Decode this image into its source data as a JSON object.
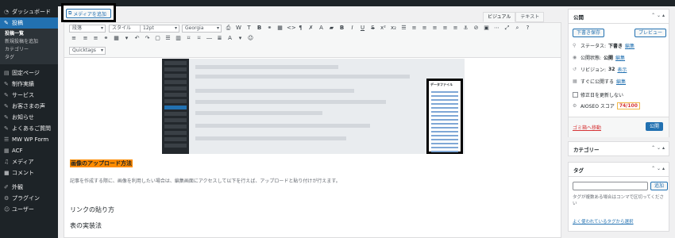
{
  "sidebar": {
    "dashboard": "ダッシュボード",
    "posts": "投稿",
    "sub": [
      "投稿一覧",
      "新規投稿を追加",
      "カテゴリー",
      "タグ"
    ],
    "items": [
      "固定ページ",
      "制作実績",
      "サービス",
      "お客さまの声",
      "お知らせ",
      "よくあるご質問",
      "MW WP Form",
      "ACF",
      "メディア",
      "コメント",
      "外観",
      "プラグイン",
      "ユーザー"
    ]
  },
  "media_button": "メディアを追加",
  "tabs": [
    "ビジュアル",
    "テキスト"
  ],
  "toolbar": {
    "format": "段落",
    "style": "スタイル",
    "size": "12pt",
    "font": "Georgia",
    "quicktags": "Quicktags"
  },
  "content": {
    "panel_title": "データファイル",
    "heading_upload": "画像のアップロード方法",
    "paragraph": "記事を作成する際に、画像を利用したい場合は、編集画面にアクセスして以下を行えば、アップロードと貼り付けが行えます。",
    "heading_link": "リンクの貼り方",
    "heading_table": "表の実装法"
  },
  "publish": {
    "title": "公開",
    "save_draft": "下書き保存",
    "preview": "プレビュー",
    "status_label": "ステータス:",
    "status_value": "下書き",
    "visibility_label": "公開状態:",
    "visibility_value": "公開",
    "revision_label": "リビジョン:",
    "revision_value": "32",
    "show": "表示",
    "publish_time": "すぐに公開する",
    "edit": "編集",
    "no_update": "修正日を更新しない",
    "aioseo_label": "AIOSEO スコア",
    "aioseo_score": "74/100",
    "trash": "ゴミ箱へ移動",
    "publish_btn": "公開"
  },
  "category": {
    "title": "カテゴリー"
  },
  "tags": {
    "title": "タグ",
    "add": "追加",
    "help": "タグが複数ある場合はコンマで区切ってください",
    "popular": "よく使われているタグから選択"
  }
}
